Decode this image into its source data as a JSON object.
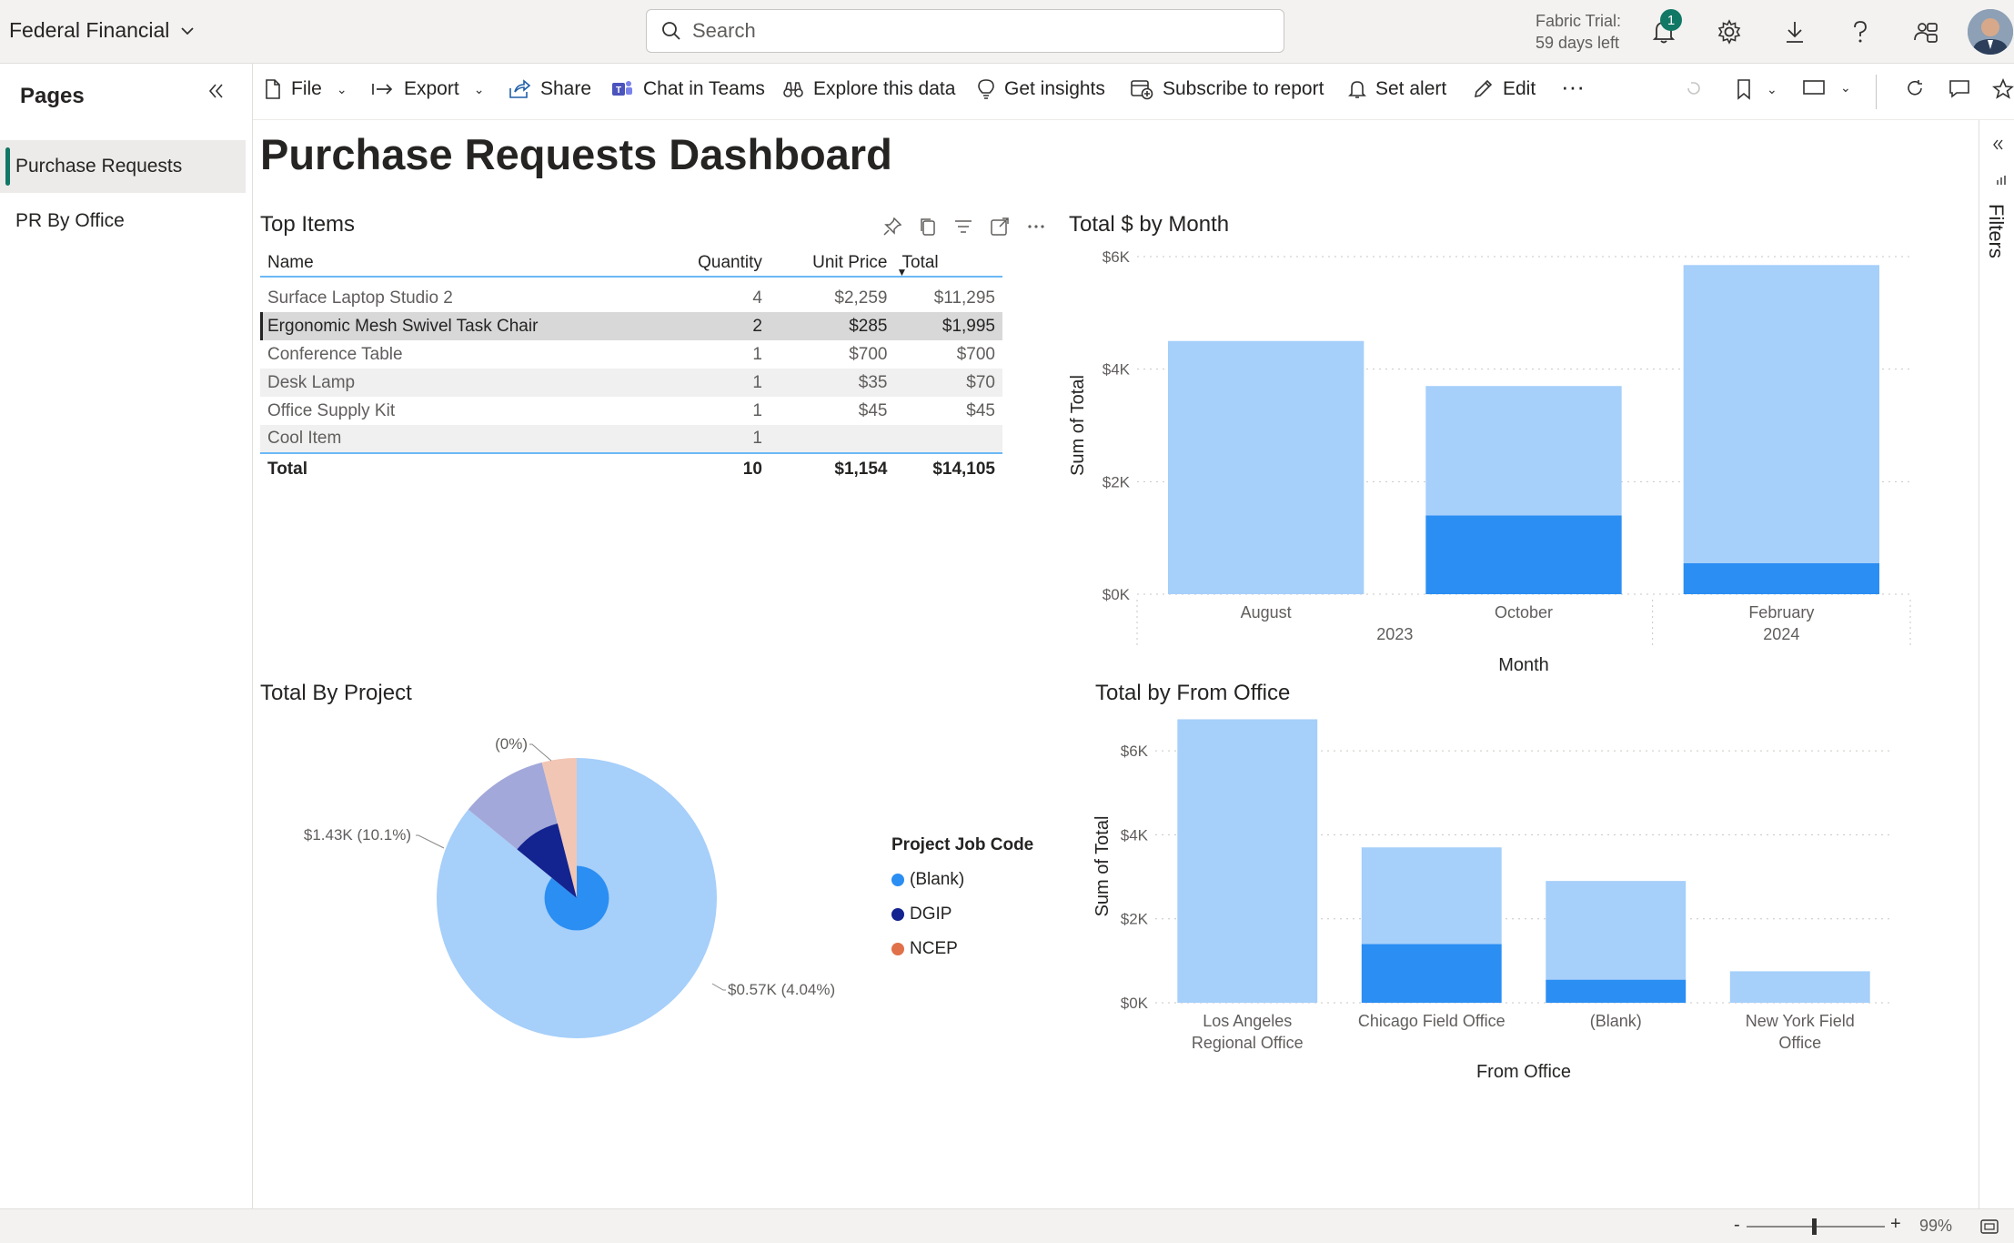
{
  "app": {
    "workspace": "Federal Financial",
    "search_placeholder": "Search",
    "trial_line1": "Fabric Trial:",
    "trial_line2": "59 days left",
    "notification_count": "1"
  },
  "pages": {
    "title": "Pages",
    "items": [
      {
        "label": "Purchase Requests",
        "active": true
      },
      {
        "label": "PR By Office",
        "active": false
      }
    ]
  },
  "toolbar": {
    "file": "File",
    "export": "Export",
    "share": "Share",
    "chat_in_teams": "Chat in Teams",
    "explore": "Explore this data",
    "insights": "Get insights",
    "subscribe": "Subscribe to report",
    "alert": "Set alert",
    "edit": "Edit",
    "more": "···"
  },
  "report": {
    "title": "Purchase Requests Dashboard",
    "filters_label": "Filters"
  },
  "top_items": {
    "title": "Top Items",
    "columns": [
      "Name",
      "Quantity",
      "Unit Price",
      "Total"
    ],
    "rows": [
      [
        "Surface Laptop Studio 2",
        "4",
        "$2,259",
        "$11,295"
      ],
      [
        "Ergonomic Mesh Swivel Task Chair",
        "2",
        "$285",
        "$1,995"
      ],
      [
        "Conference Table",
        "1",
        "$700",
        "$700"
      ],
      [
        "Desk Lamp",
        "1",
        "$35",
        "$70"
      ],
      [
        "Office Supply Kit",
        "1",
        "$45",
        "$45"
      ],
      [
        "Cool Item",
        "1",
        "",
        ""
      ]
    ],
    "total": [
      "Total",
      "10",
      "$1,154",
      "$14,105"
    ]
  },
  "status": {
    "zoom": "99%",
    "minus": "-",
    "plus": "+"
  },
  "chart_data": [
    {
      "type": "bar",
      "title": "Total $ by Month",
      "xlabel": "Month",
      "ylabel": "Sum of Total",
      "categories": [
        "August",
        "October",
        "February"
      ],
      "year_labels": [
        "2023",
        "2024"
      ],
      "ylim": [
        0,
        6000
      ],
      "yticks": [
        "$0K",
        "$2K",
        "$4K",
        "$6K"
      ],
      "stacked": true,
      "series": [
        {
          "values": [
            0,
            1400,
            550
          ],
          "color": "#2b8ef2"
        },
        {
          "values": [
            4500,
            2300,
            5300
          ],
          "color": "#a6cffa"
        }
      ]
    },
    {
      "type": "pie",
      "title": "Total By Project",
      "legend_title": "Project Job Code",
      "legend": [
        {
          "name": "(Blank)",
          "color": "#2b8ef2"
        },
        {
          "name": "DGIP",
          "color": "#13238f"
        },
        {
          "name": "NCEP",
          "color": "#e0714a"
        }
      ],
      "slices": [
        {
          "value": 0.859,
          "color": "#a6cffa"
        },
        {
          "value": 0.101,
          "color": "#a2a8d9"
        },
        {
          "value": 0.04,
          "color": "#f2c6b4"
        }
      ],
      "inner_slices": [
        {
          "value": 0.859,
          "color": "#2b8ef2",
          "radius": 0.23
        },
        {
          "value": 0.101,
          "color": "#13238f",
          "radius": 0.55
        }
      ],
      "labels": [
        "$0.57K (4.04%)",
        "$1.43K (10.1%)",
        "(0%)"
      ]
    },
    {
      "type": "bar",
      "title": "Total by From Office",
      "xlabel": "From Office",
      "ylabel": "Sum of Total",
      "categories": [
        [
          "Los Angeles",
          "Regional Office"
        ],
        [
          "Chicago Field Office"
        ],
        [
          "(Blank)"
        ],
        [
          "New York Field",
          "Office"
        ]
      ],
      "ylim": [
        0,
        6500
      ],
      "yticks": [
        "$0K",
        "$2K",
        "$4K",
        "$6K"
      ],
      "stacked": true,
      "series": [
        {
          "values": [
            0,
            1400,
            550,
            0
          ],
          "color": "#2b8ef2"
        },
        {
          "values": [
            6750,
            2300,
            2350,
            750
          ],
          "color": "#a6cffa"
        }
      ]
    }
  ]
}
